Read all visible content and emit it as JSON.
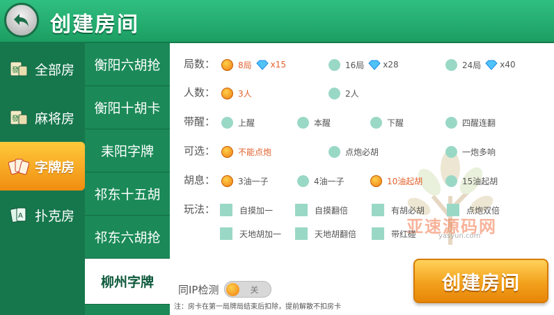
{
  "header": {
    "title": "创建房间",
    "back_icon": "back-arrow-icon"
  },
  "categories": [
    {
      "label": "全部房",
      "icon": "mahjong-tile-icon"
    },
    {
      "label": "麻将房",
      "icon": "mahjong-tile-icon"
    },
    {
      "label": "字牌房",
      "icon": "zipai-cards-icon",
      "active": true
    },
    {
      "label": "扑克房",
      "icon": "poker-cards-icon"
    }
  ],
  "games": [
    {
      "label": "衡阳六胡抢"
    },
    {
      "label": "衡阳十胡卡"
    },
    {
      "label": "耒阳字牌"
    },
    {
      "label": "祁东十五胡"
    },
    {
      "label": "祁东六胡抢"
    },
    {
      "label": "柳州字牌",
      "active": true
    }
  ],
  "settings": {
    "rounds": {
      "label": "局数：",
      "options": [
        {
          "text": "8局",
          "cost": "x15",
          "selected": true
        },
        {
          "text": "16局",
          "cost": "x28"
        },
        {
          "text": "24局",
          "cost": "x40"
        }
      ]
    },
    "players": {
      "label": "人数：",
      "options": [
        {
          "text": "3人",
          "selected": true
        },
        {
          "text": "2人"
        }
      ]
    },
    "xing": {
      "label": "带醒：",
      "options": [
        {
          "text": "上醒"
        },
        {
          "text": "本醒"
        },
        {
          "text": "下醒"
        },
        {
          "text": "四醒连翻"
        }
      ]
    },
    "optional": {
      "label": "可选：",
      "options": [
        {
          "text": "不能点炮",
          "selected": true
        },
        {
          "text": "点炮必胡"
        },
        {
          "text": "一炮多响"
        }
      ]
    },
    "huxi": {
      "label": "胡息：",
      "options": [
        {
          "text": "3油一子"
        },
        {
          "text": "4油一子"
        },
        {
          "text": "10油起胡",
          "selected": true
        },
        {
          "text": "15油起胡"
        }
      ]
    },
    "play": {
      "label": "玩法：",
      "options": [
        {
          "text": "自摸加一"
        },
        {
          "text": "自摸翻倍"
        },
        {
          "text": "有胡必胡"
        },
        {
          "text": "点炮双倍"
        },
        {
          "text": "天地胡加一"
        },
        {
          "text": "天地胡翻倍"
        },
        {
          "text": "带红碰"
        }
      ]
    }
  },
  "ip_check": {
    "label": "同IP检测",
    "state": "关"
  },
  "create_button": "创建房间",
  "note": "注：房卡在第一局牌局结束后扣除，提前解散不扣房卡",
  "watermark": {
    "text": "亚速源码网",
    "url": "yasyun.com"
  },
  "colors": {
    "accent": "#f3a11c",
    "header": "#1d9e63",
    "selected_text": "#e2622f"
  }
}
